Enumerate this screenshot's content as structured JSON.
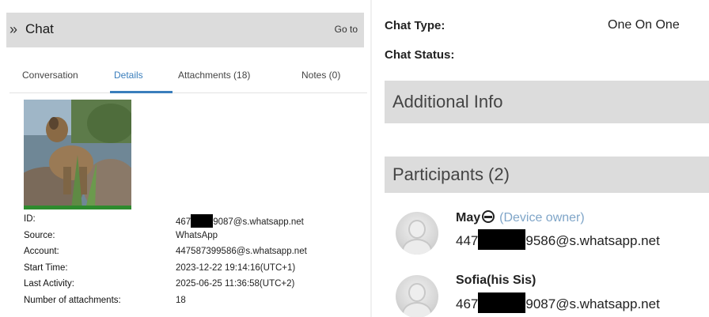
{
  "header": {
    "title": "Chat",
    "goto_label": "Go to"
  },
  "tabs": [
    {
      "label": "Conversation",
      "active": false
    },
    {
      "label": "Details",
      "active": true
    },
    {
      "label": "Attachments (18)",
      "active": false
    },
    {
      "label": "Notes (0)",
      "active": false
    }
  ],
  "details": [
    {
      "label": "ID:",
      "value_prefix": "467",
      "value_suffix": "9087@s.whatsapp.net",
      "redacted": true
    },
    {
      "label": "Source:",
      "value": "WhatsApp"
    },
    {
      "label": "Account:",
      "value": "447587399586@s.whatsapp.net"
    },
    {
      "label": "Start Time:",
      "value": "2023-12-22 19:14:16(UTC+1)"
    },
    {
      "label": "Last Activity:",
      "value": "2025-06-25 11:36:58(UTC+2)"
    },
    {
      "label": "Number of attachments:",
      "value": "18"
    }
  ],
  "chat_info": {
    "type_label": "Chat Type:",
    "type_value": "One On One",
    "status_label": "Chat Status:"
  },
  "sections": {
    "additional_info": "Additional Info",
    "participants": "Participants (2)"
  },
  "participants": [
    {
      "name": "May",
      "owner_label": "(Device owner)",
      "addr_prefix": "447",
      "addr_suffix": "9586@s.whatsapp.net"
    },
    {
      "name": "Sofia(his Sis)",
      "owner_label": "",
      "addr_prefix": "467",
      "addr_suffix": "9087@s.whatsapp.net"
    }
  ],
  "colors": {
    "accent": "#3a7ebc",
    "header_bg": "#dcdcdc",
    "owner": "#7fa5c8",
    "photo_bar": "#2e8b2e"
  },
  "icons": {
    "header_chevron": "double-chevron-right-icon",
    "avatar": "default-avatar-icon",
    "emoji": "emoji-icon"
  }
}
